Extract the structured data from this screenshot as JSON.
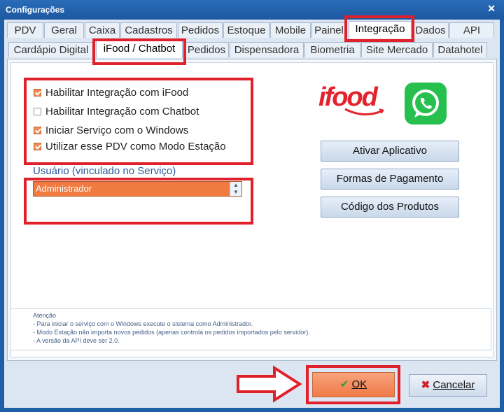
{
  "window": {
    "title": "Configurações",
    "close": "✕"
  },
  "tabs_row1": [
    "PDV",
    "Geral",
    "Caixa",
    "Cadastros",
    "Pedidos",
    "Estoque",
    "Mobile",
    "Painel",
    "Integração",
    "Dados",
    "API"
  ],
  "tabs_row2": [
    "Cardápio Digital",
    "iFood / Chatbot",
    "Pedidos",
    "Dispensadora",
    "Biometria",
    "Site Mercado",
    "Datahotel"
  ],
  "active_row1": "Integração",
  "active_row2": "iFood / Chatbot",
  "options": [
    {
      "label": "Habilitar Integração com iFood",
      "checked": true
    },
    {
      "label": "Habilitar Integração com Chatbot",
      "checked": false
    },
    {
      "label": "Iniciar Serviço com o Windows",
      "checked": true
    },
    {
      "label": "Utilizar esse PDV como Modo Estação",
      "checked": true
    }
  ],
  "user": {
    "label": "Usuário (vinculado no Serviço)",
    "value": "Administrador"
  },
  "logos": {
    "ifood": "ifood",
    "whatsapp_icon": "whatsapp-icon"
  },
  "buttons": [
    "Ativar Aplicativo",
    "Formas de Pagamento",
    "Código dos Produtos"
  ],
  "notes": [
    "Atenção",
    "- Para iniciar o serviço com o Windows execute o sistema como Administrador.",
    "- Modo Estação não importa novos pedidos (apenas controla os pedidos importados pelo servidor).",
    "- A versão da API deve ser 2.0."
  ],
  "footer": {
    "ok": "OK",
    "cancel": "Cancelar"
  },
  "colors": {
    "accent": "#f07a40",
    "highlight": "#e0202a",
    "window": "#1f5fa8",
    "ifood": "#e3222b",
    "whatsapp": "#27c04f"
  }
}
